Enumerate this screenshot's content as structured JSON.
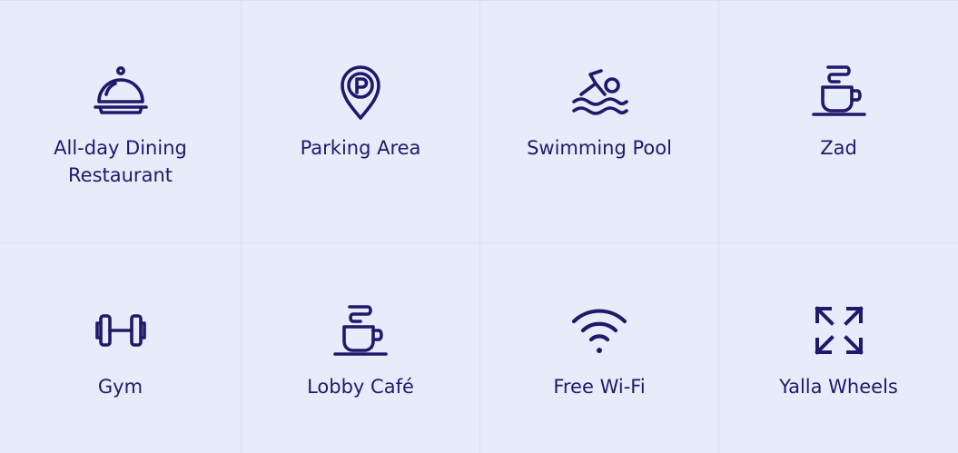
{
  "amenities": [
    {
      "label": "All-day Dining Restaurant",
      "icon": "dining-cloche-icon"
    },
    {
      "label": "Parking Area",
      "icon": "parking-pin-icon"
    },
    {
      "label": "Swimming Pool",
      "icon": "swimmer-icon"
    },
    {
      "label": "Zad",
      "icon": "coffee-cup-icon"
    },
    {
      "label": "Gym",
      "icon": "dumbbell-icon"
    },
    {
      "label": "Lobby Café",
      "icon": "coffee-cup-icon"
    },
    {
      "label": "Free Wi-Fi",
      "icon": "wifi-icon"
    },
    {
      "label": "Yalla Wheels",
      "icon": "expand-arrows-icon"
    }
  ],
  "colors": {
    "background": "#e6ecfa",
    "divider": "#d9e0ef",
    "icon_and_text": "#22186b"
  }
}
